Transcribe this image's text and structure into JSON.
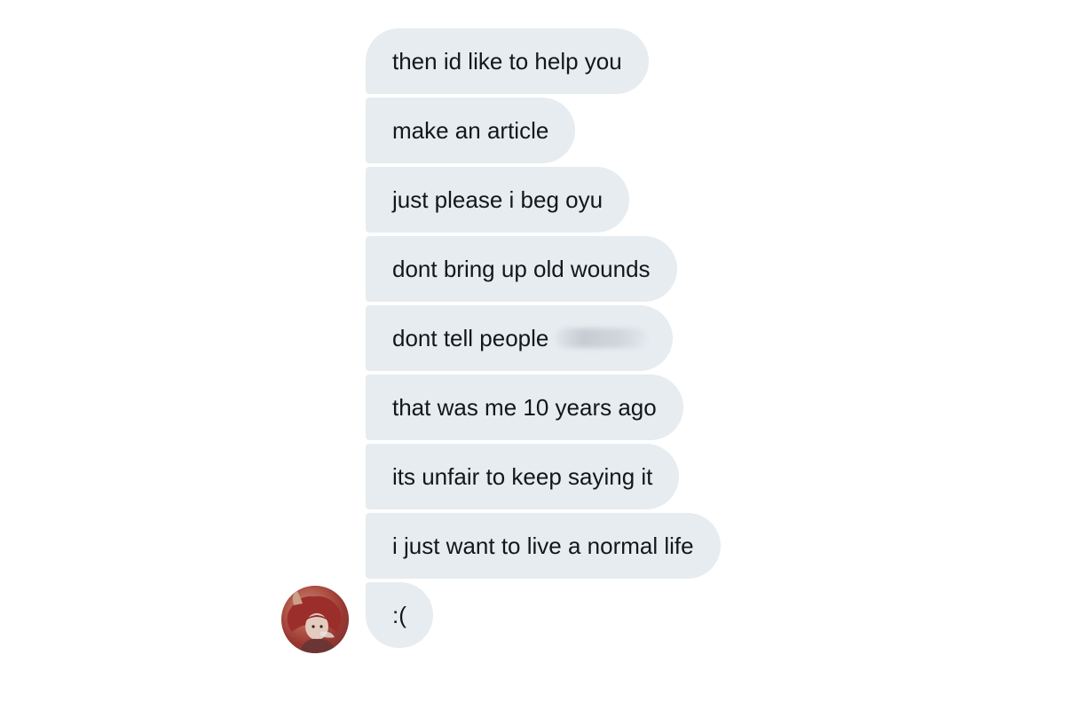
{
  "conversation": {
    "messages": [
      {
        "text": "then id like to help you"
      },
      {
        "text": "make an article"
      },
      {
        "text": "just please i beg oyu"
      },
      {
        "text": "dont bring up old wounds"
      },
      {
        "text": "dont tell people"
      },
      {
        "text": "that was me 10 years ago"
      },
      {
        "text": "its unfair to keep saying it"
      },
      {
        "text": "i just want to live a normal life"
      },
      {
        "text": ":("
      }
    ]
  },
  "colors": {
    "bubble_background": "#e6ecf0",
    "text": "#14171a",
    "page_background": "#ffffff"
  },
  "icons": {
    "avatar": "user-avatar-image"
  }
}
